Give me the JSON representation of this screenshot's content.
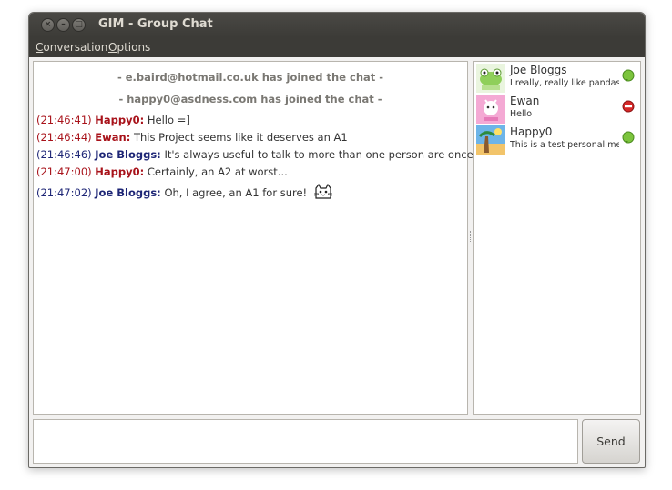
{
  "window": {
    "title": "GIM - Group Chat"
  },
  "menu": {
    "conversation": "Conversation",
    "conversation_key": "C",
    "conversation_rest": "onversation",
    "options": "Options",
    "options_key": "O",
    "options_rest": "ptions"
  },
  "chat": {
    "system_messages": [
      "- e.baird@hotmail.co.uk has joined the chat -",
      "- happy0@asdness.com has joined the chat -"
    ],
    "messages": [
      {
        "time": "(21:46:41)",
        "nick": "Happy0:",
        "text": "Hello =]",
        "color": "#a8121a"
      },
      {
        "time": "(21:46:44)",
        "nick": "Ewan:",
        "text": "This Project seems like it deserves an A1",
        "color": "#a8121a"
      },
      {
        "time": "(21:46:46)",
        "nick": "Joe Bloggs:",
        "text": "It's always useful to talk to more than one person are once",
        "color": "#1e2676"
      },
      {
        "time": "(21:47:00)",
        "nick": "Happy0:",
        "text": "Certainly, an A2 at worst...",
        "color": "#a8121a"
      },
      {
        "time": "(21:47:02)",
        "nick": "Joe Bloggs:",
        "text": "Oh, I agree, an A1 for sure!",
        "color": "#1e2676",
        "emote": "cat-emoticon-icon"
      }
    ]
  },
  "contacts": [
    {
      "name": "Joe Bloggs",
      "status_text": "I really, really like pandas.",
      "status": "online",
      "avatar": "lizard-avatar"
    },
    {
      "name": "Ewan",
      "status_text": "Hello",
      "status": "busy",
      "avatar": "pink-cartoon-avatar"
    },
    {
      "name": "Happy0",
      "status_text": "This is a test personal message",
      "status": "online",
      "avatar": "beach-avatar"
    }
  ],
  "input": {
    "send_label": "Send"
  }
}
